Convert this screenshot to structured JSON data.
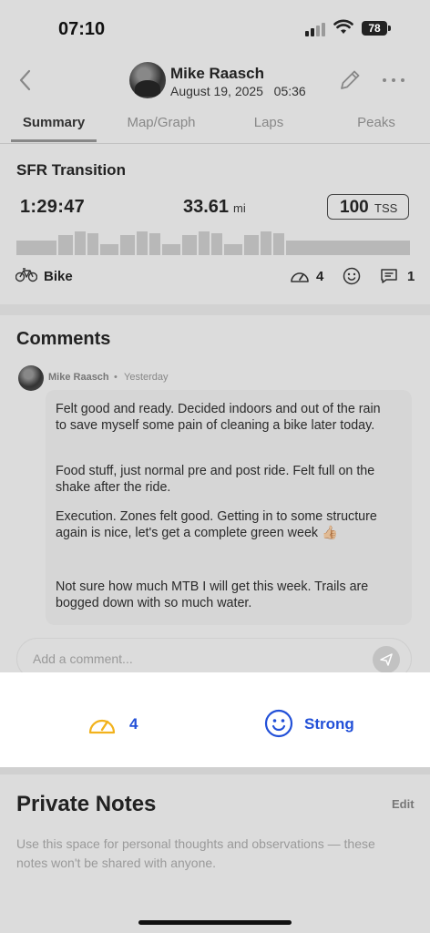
{
  "status": {
    "time": "07:10",
    "battery": "78"
  },
  "header": {
    "athlete_name": "Mike Raasch",
    "date": "August 19, 2025",
    "time": "05:36"
  },
  "tabs": [
    {
      "label": "Summary",
      "active": true
    },
    {
      "label": "Map/Graph",
      "active": false
    },
    {
      "label": "Laps",
      "active": false
    },
    {
      "label": "Peaks",
      "active": false
    }
  ],
  "activity": {
    "title": "SFR Transition",
    "duration": "1:29:47",
    "distance": "33.61",
    "distance_unit": "mi",
    "tss_value": "100",
    "tss_unit": "TSS",
    "sport": "Bike",
    "rpe": "4",
    "comment_count": "1"
  },
  "comments": {
    "heading": "Comments",
    "items": [
      {
        "author": "Mike Raasch",
        "separator": "•",
        "time": "Yesterday",
        "paragraphs": [
          "Felt good and ready. Decided indoors and out of the rain to save myself some pain of cleaning a bike later today.",
          "Food stuff, just normal pre and post ride. Felt full on the shake after the ride.",
          "Execution. Zones felt good. Getting in to some structure again is nice, let's get a complete green week 👍🏼",
          "Not sure how much MTB I will get this week. Trails are bogged down with so much water."
        ]
      }
    ],
    "add_placeholder": "Add a comment..."
  },
  "feedback": {
    "rpe_value": "4",
    "feel_label": "Strong",
    "accent_color": "#2250d8",
    "gauge_color": "#f2b21c"
  },
  "private_notes": {
    "title": "Private Notes",
    "edit_label": "Edit",
    "hint": "Use this space for personal thoughts and observations — these notes won't be shared with anyone."
  }
}
